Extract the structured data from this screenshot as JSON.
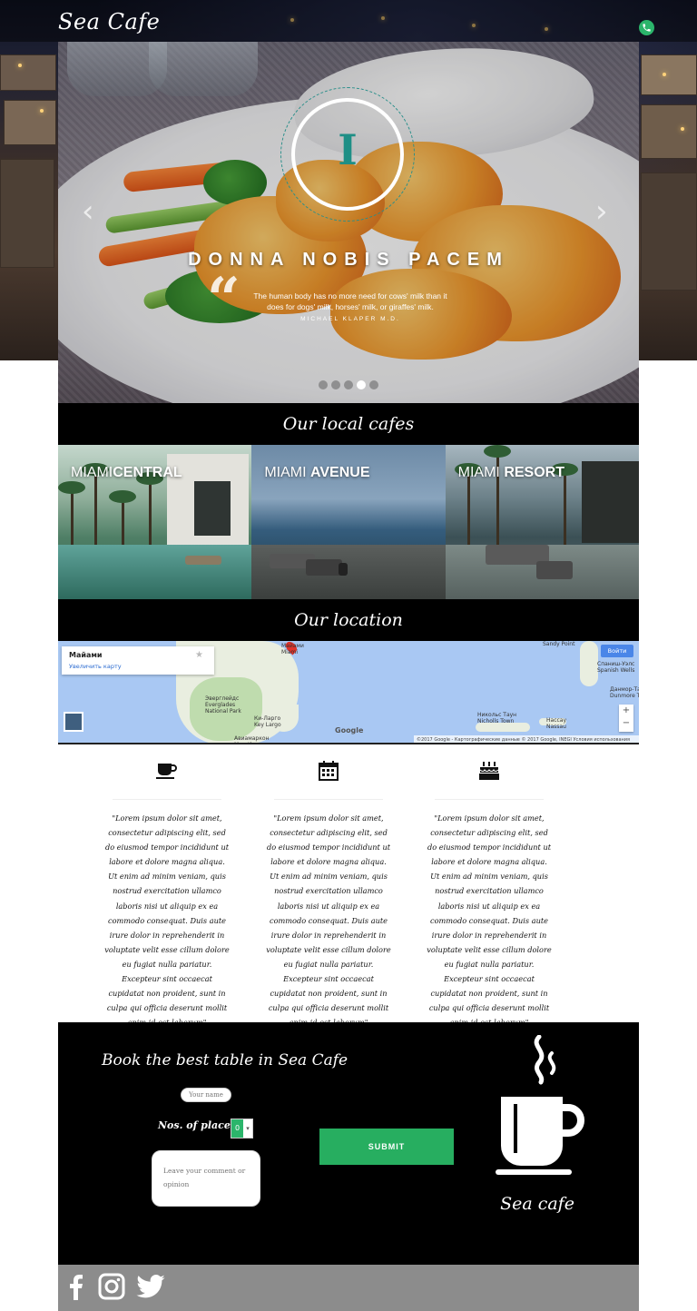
{
  "header": {
    "brand": "Sea Cafe",
    "phone_icon": "phone-icon"
  },
  "carousel": {
    "quote_letter": "I",
    "title": "DONNA NOBIS PACEM",
    "quote": "The human body has no more need for cows' milk than it does for dogs' milk, horses' milk, or giraffes' milk.",
    "author": "MICHAEL KLAPER M.D.",
    "prev_label": "‹",
    "next_label": "›",
    "slides_count": 5,
    "active_slide": 4
  },
  "cafes": {
    "heading": "Our local cafes",
    "items": [
      {
        "prefix": "MIAMI",
        "name": "CENTRAL"
      },
      {
        "prefix": "MIAMI",
        "name": "AVENUE"
      },
      {
        "prefix": "MIAMI",
        "name": "RESORT"
      }
    ]
  },
  "location": {
    "heading": "Our location",
    "map": {
      "city": "Майами",
      "enlarge_link": "Увеличить карту",
      "login": "Войти",
      "pin_label": "Майами\nMiami",
      "labels": {
        "everglades": "Эверглейдс\nEverglades\nNational Park",
        "key_largo": "Ки-Ларго\nKey Largo",
        "nassau": "Нассау\nNassau",
        "nicholls": "Никольс Таун\nNicholls Town",
        "sandy_point": "Sandy Point",
        "spanish_wells": "Спаниш-Уэлс\nSpanish Wells",
        "dunmore": "Данмор-Таун\nDunmore Town",
        "marathon": "Авиамаркон\nMarathon"
      },
      "google": "Google",
      "copyright": "©2017 Google - Картографические данные © 2017 Google, INEGI   Условия использования"
    }
  },
  "features": [
    {
      "icon": "coffee-cup-icon",
      "text": "\"Lorem ipsum dolor sit amet, consectetur adipiscing elit, sed do eiusmod tempor incididunt ut labore et dolore magna aliqua. Ut enim ad minim veniam, quis nostrud exercitation ullamco laboris nisi ut aliquip ex ea commodo consequat. Duis aute irure dolor in reprehenderit in voluptate velit esse cillum dolore eu fugiat nulla pariatur. Excepteur sint occaecat cupidatat non proident, sunt in culpa qui officia deserunt mollit anim id est laborum\""
    },
    {
      "icon": "calendar-icon",
      "text": "\"Lorem ipsum dolor sit amet, consectetur adipiscing elit, sed do eiusmod tempor incididunt ut labore et dolore magna aliqua. Ut enim ad minim veniam, quis nostrud exercitation ullamco laboris nisi ut aliquip ex ea commodo consequat. Duis aute irure dolor in reprehenderit in voluptate velit esse cillum dolore eu fugiat nulla pariatur. Excepteur sint occaecat cupidatat non proident, sunt in culpa qui officia deserunt mollit anim id est laborum\""
    },
    {
      "icon": "birthday-cake-icon",
      "text": "\"Lorem ipsum dolor sit amet, consectetur adipiscing elit, sed do eiusmod tempor incididunt ut labore et dolore magna aliqua. Ut enim ad minim veniam, quis nostrud exercitation ullamco laboris nisi ut aliquip ex ea commodo consequat. Duis aute irure dolor in reprehenderit in voluptate velit esse cillum dolore eu fugiat nulla pariatur. Excepteur sint occaecat cupidatat non proident, sunt in culpa qui officia deserunt mollit anim id est laborum\""
    }
  ],
  "booking": {
    "title": "Book the best table in Sea Cafe",
    "name_placeholder": "Your name",
    "places_label": "Nos. of places:",
    "places_value": "0",
    "comment_placeholder": "Leave your comment or opinion",
    "submit_label": "SUBMIT",
    "logo_text": "Sea cafe"
  },
  "footer": {
    "social": [
      "facebook-icon",
      "instagram-icon",
      "twitter-icon"
    ]
  },
  "colors": {
    "accent_green": "#27ae60",
    "bar_black": "#000000",
    "footer_gray": "#8c8c8c",
    "quote_teal": "#1e8f86"
  }
}
